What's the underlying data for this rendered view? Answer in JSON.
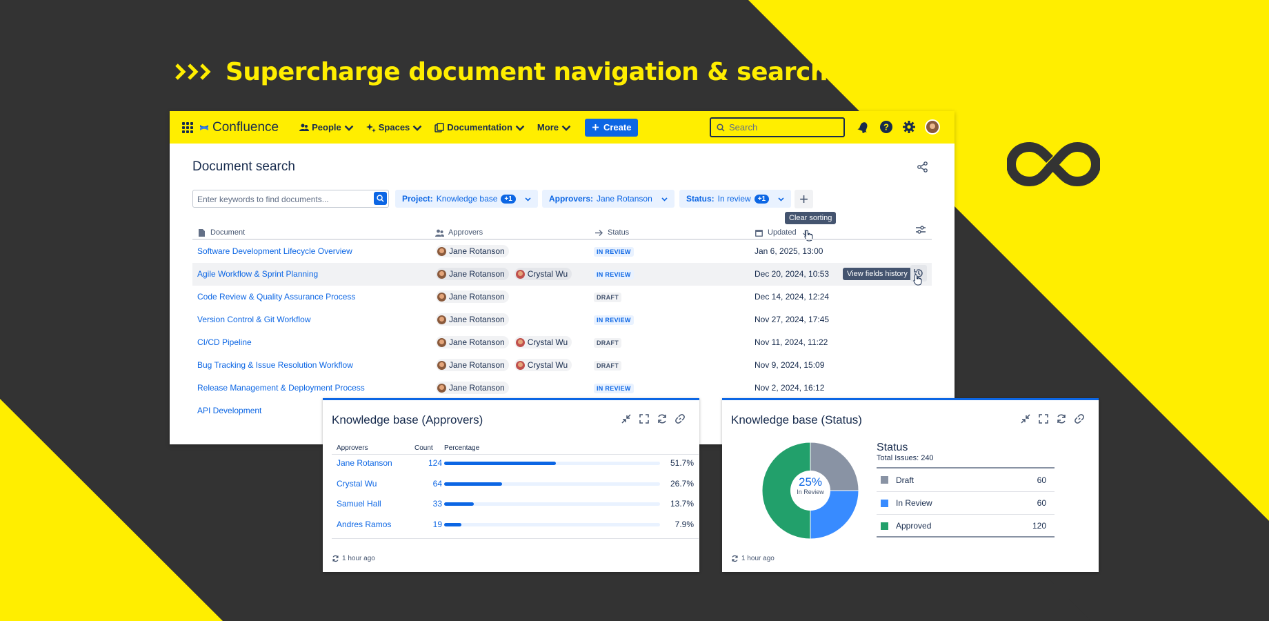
{
  "headline": "Supercharge document navigation & search",
  "app": {
    "logo_text": "Confluence",
    "nav": [
      {
        "label": "People",
        "icon": "people-icon"
      },
      {
        "label": "Spaces",
        "icon": "spaces-icon"
      },
      {
        "label": "Documentation",
        "icon": "documentation-icon"
      },
      {
        "label": "More",
        "icon": ""
      }
    ],
    "create_label": "Create",
    "search_placeholder": "Search"
  },
  "page": {
    "title": "Document search",
    "keyword_placeholder": "Enter keywords to find documents...",
    "filters": [
      {
        "key": "Project:",
        "value": "Knowledge base",
        "badge": "+1"
      },
      {
        "key": "Approvers:",
        "value": "Jane Rotanson",
        "badge": ""
      },
      {
        "key": "Status:",
        "value": "In review",
        "badge": "+1"
      }
    ],
    "tooltip_sort": "Clear sorting",
    "tooltip_history": "View fields history",
    "columns": {
      "document": "Document",
      "approvers": "Approvers",
      "status": "Status",
      "updated": "Updated"
    },
    "rows": [
      {
        "doc": "Software Development Lifecycle Overview",
        "approvers": [
          "Jane Rotanson"
        ],
        "status": "IN REVIEW",
        "updated": "Jan 6, 2025, 13:00"
      },
      {
        "doc": "Agile Workflow & Sprint Planning",
        "approvers": [
          "Jane Rotanson",
          "Crystal Wu"
        ],
        "status": "IN REVIEW",
        "updated": "Dec 20, 2024, 10:53"
      },
      {
        "doc": "Code Review & Quality Assurance Process",
        "approvers": [
          "Jane Rotanson"
        ],
        "status": "DRAFT",
        "updated": "Dec 14, 2024, 12:24"
      },
      {
        "doc": "Version Control & Git Workflow",
        "approvers": [
          "Jane Rotanson"
        ],
        "status": "IN REVIEW",
        "updated": "Nov 27, 2024, 17:45"
      },
      {
        "doc": "CI/CD Pipeline",
        "approvers": [
          "Jane Rotanson",
          "Crystal Wu"
        ],
        "status": "DRAFT",
        "updated": "Nov 11, 2024, 11:22"
      },
      {
        "doc": "Bug Tracking & Issue Resolution Workflow",
        "approvers": [
          "Jane Rotanson",
          "Crystal Wu"
        ],
        "status": "DRAFT",
        "updated": "Nov 9, 2024, 15:09"
      },
      {
        "doc": "Release Management & Deployment Process",
        "approvers": [
          "Jane Rotanson"
        ],
        "status": "IN REVIEW",
        "updated": "Nov 2, 2024, 16:12"
      },
      {
        "doc": "API Development",
        "approvers": [],
        "status": "",
        "updated": ""
      }
    ]
  },
  "approvers_card": {
    "title": "Knowledge base (Approvers)",
    "headers": {
      "name": "Approvers",
      "count": "Count",
      "pct": "Percentage"
    },
    "rows": [
      {
        "name": "Jane Rotanson",
        "count": "124",
        "pct": "51.7%",
        "fraction": 0.517
      },
      {
        "name": "Crystal Wu",
        "count": "64",
        "pct": "26.7%",
        "fraction": 0.267
      },
      {
        "name": "Samuel Hall",
        "count": "33",
        "pct": "13.7%",
        "fraction": 0.137
      },
      {
        "name": "Andres Ramos",
        "count": "19",
        "pct": "7.9%",
        "fraction": 0.079
      }
    ],
    "footer": "1 hour ago"
  },
  "status_card": {
    "title": "Knowledge base (Status)",
    "center_value": "25%",
    "center_label": "In Review",
    "legend_title": "Status",
    "legend_subtitle": "Total Issues: 240",
    "footer": "1 hour ago"
  },
  "chart_data": {
    "type": "pie",
    "categories": [
      "Draft",
      "In Review",
      "Approved"
    ],
    "values": [
      60,
      60,
      120
    ],
    "colors": [
      "#8993a4",
      "#388bff",
      "#22a06b"
    ]
  },
  "colors": {
    "yellow": "#ffee00",
    "dark": "#333333",
    "brand_blue": "#0c66e4"
  }
}
